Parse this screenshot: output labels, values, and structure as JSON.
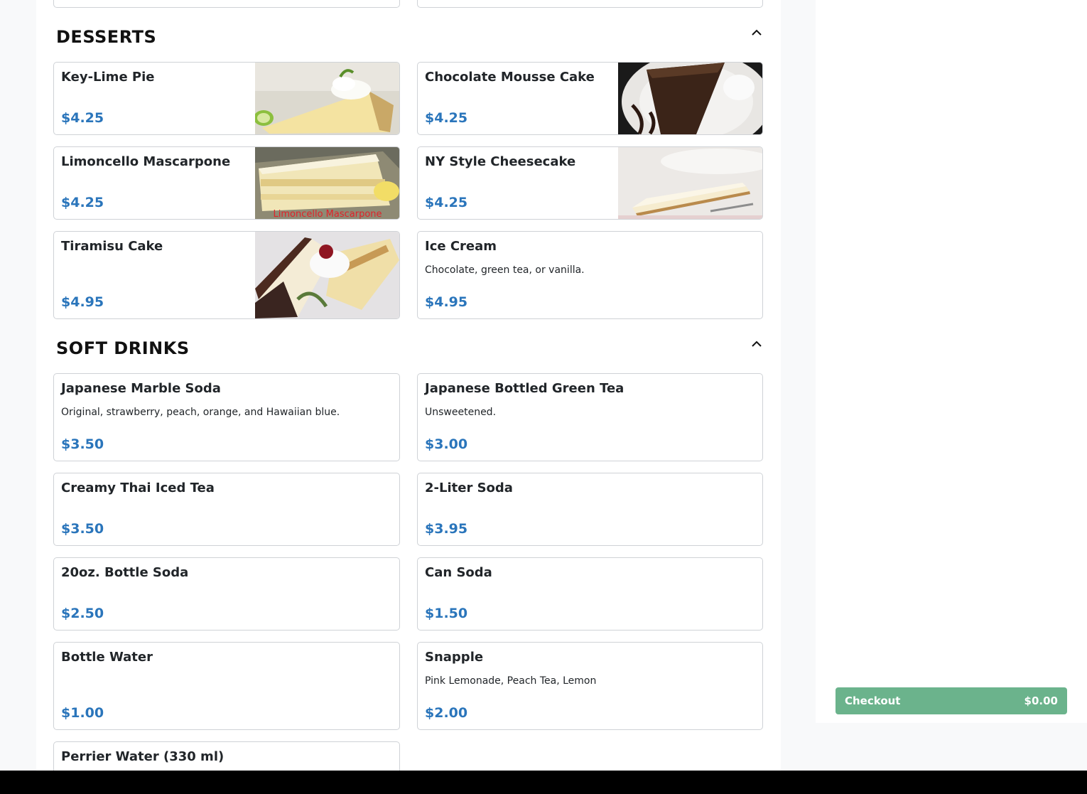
{
  "sections": [
    {
      "title": "DESSERTS"
    },
    {
      "title": "SOFT DRINKS"
    }
  ],
  "desserts": [
    {
      "name": "Key-Lime Pie",
      "price": "$4.25",
      "image": "key-lime-pie-photo"
    },
    {
      "name": "Chocolate Mousse Cake",
      "price": "$4.25",
      "image": "chocolate-mousse-cake-photo"
    },
    {
      "name": "Limoncello Mascarpone",
      "price": "$4.25",
      "image": "limoncello-mascarpone-photo",
      "image_caption": "Limoncello Mascarpone"
    },
    {
      "name": "NY Style Cheesecake",
      "price": "$4.25",
      "image": "ny-style-cheesecake-photo"
    },
    {
      "name": "Tiramisu Cake",
      "price": "$4.95",
      "image": "tiramisu-cake-photo"
    },
    {
      "name": "Ice Cream",
      "desc": "Chocolate, green tea, or vanilla.",
      "price": "$4.95"
    }
  ],
  "drinks": [
    {
      "name": "Japanese Marble Soda",
      "desc": "Original, strawberry, peach, orange, and Hawaiian blue.",
      "price": "$3.50"
    },
    {
      "name": "Japanese Bottled Green Tea",
      "desc": "Unsweetened.",
      "price": "$3.00"
    },
    {
      "name": "Creamy Thai Iced Tea",
      "price": "$3.50"
    },
    {
      "name": "2-Liter Soda",
      "price": "$3.95"
    },
    {
      "name": "20oz. Bottle Soda",
      "price": "$2.50"
    },
    {
      "name": "Can Soda",
      "price": "$1.50"
    },
    {
      "name": "Bottle Water",
      "price": "$1.00"
    },
    {
      "name": "Snapple",
      "desc": "Pink Lemonade, Peach Tea, Lemon",
      "price": "$2.00"
    },
    {
      "name": "Perrier Water (330 ml)"
    }
  ],
  "checkout": {
    "label": "Checkout",
    "total": "$0.00"
  },
  "colors": {
    "price": "#2a75bb",
    "checkout": "#6bb38c"
  }
}
